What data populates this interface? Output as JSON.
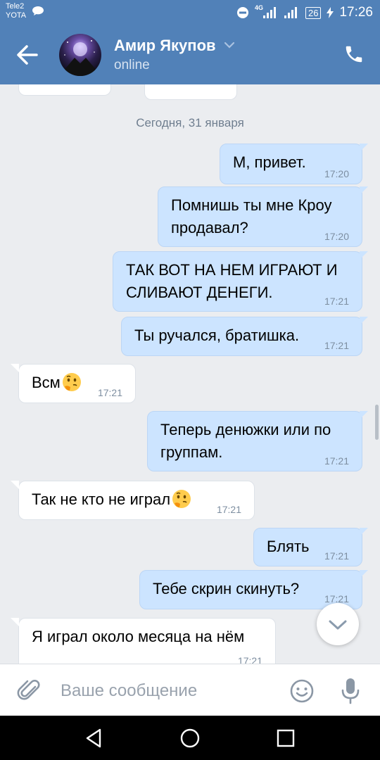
{
  "status_bar": {
    "carrier_1": "Tele2",
    "carrier_2": "YOTA",
    "network_type": "4G",
    "battery": "26",
    "time": "17:26"
  },
  "header": {
    "contact_name": "Амир Якупов",
    "status": "online",
    "back_icon": "arrow-left-icon",
    "call_icon": "phone-icon"
  },
  "date_separator": "Сегодня, 31 января",
  "messages": [
    {
      "direction": "out",
      "text": "М, привет.",
      "time": "17:20"
    },
    {
      "direction": "out",
      "text": "Помнишь ты мне Кроу продавал?",
      "time": "17:20"
    },
    {
      "direction": "out",
      "text": "ТАК ВОТ НА НЕМ ИГРАЮТ И СЛИВАЮТ ДЕНЕГИ.",
      "time": "17:21"
    },
    {
      "direction": "out",
      "text": "Ты ручался, братишка.",
      "time": "17:21"
    },
    {
      "direction": "in",
      "text": "Всм",
      "emoji": "thinking-face-emoji",
      "time": "17:21"
    },
    {
      "direction": "out",
      "text": "Теперь денюжки или по группам.",
      "time": "17:21"
    },
    {
      "direction": "in",
      "text": "Так не кто не играл",
      "emoji": "thinking-face-emoji",
      "time": "17:21"
    },
    {
      "direction": "out",
      "text": "Блять",
      "time": "17:21"
    },
    {
      "direction": "out",
      "text": "Тебе скрин скинуть?",
      "time": "17:21"
    },
    {
      "direction": "in",
      "text": "Я играл около месяца на нём",
      "time": "17:21"
    }
  ],
  "composer": {
    "placeholder": "Ваше сообщение"
  },
  "colors": {
    "header_bg": "#5181b8",
    "chat_bg": "#ebedf0",
    "outgoing_bubble": "#cce4ff",
    "incoming_bubble": "#ffffff",
    "time_text": "#7d8ea0"
  }
}
